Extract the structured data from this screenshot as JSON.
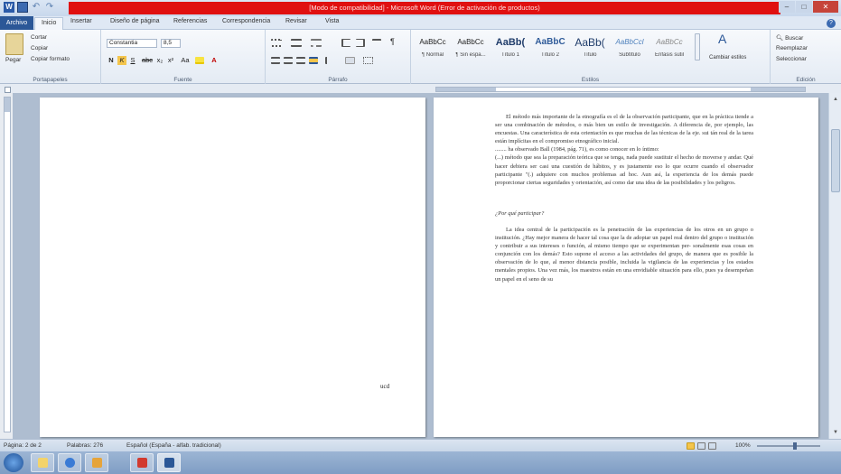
{
  "window": {
    "title": "[Modo de compatibilidad] - Microsoft Word (Error de activación de productos)",
    "minimize": "–",
    "maximize": "□",
    "close": "✕"
  },
  "tabs": {
    "file": "Archivo",
    "items": [
      "Inicio",
      "Insertar",
      "Diseño de página",
      "Referencias",
      "Correspondencia",
      "Revisar",
      "Vista"
    ],
    "help": "?"
  },
  "ribbon": {
    "clipboard": {
      "label": "Portapapeles",
      "paste": "Pegar",
      "cut": "Cortar",
      "copy": "Copiar",
      "format_painter": "Copiar formato"
    },
    "font": {
      "label": "Fuente",
      "font_name": "Constantia",
      "font_size": "8,5",
      "buttons": [
        "N",
        "K",
        "S",
        "abc",
        "x₂",
        "x²",
        "Aa",
        "A"
      ]
    },
    "paragraph": {
      "label": "Párrafo",
      "pilcrow": "¶"
    },
    "styles": {
      "label": "Estilos",
      "items": [
        {
          "sample": "AaBbCc",
          "name": "¶ Normal"
        },
        {
          "sample": "AaBbCc",
          "name": "¶ Sin espa..."
        },
        {
          "sample": "AaBb(",
          "name": "Título 1"
        },
        {
          "sample": "AaBbC",
          "name": "Título 2"
        },
        {
          "sample": "AaBb(",
          "name": "Título"
        },
        {
          "sample": "AaBbCcl",
          "name": "Subtítulo"
        },
        {
          "sample": "AaBbCc",
          "name": "Énfasis sutil"
        }
      ],
      "change_styles": "Cambiar estilos"
    },
    "editing": {
      "label": "Edición",
      "find": "Buscar",
      "replace": "Reemplazar",
      "select": "Seleccionar"
    }
  },
  "document": {
    "page_number": "ucd",
    "paragraphs": [
      "El método más importante de la etnografía es el de la observación partic­ipante, que en la práctica tiende a ser una combinación de métodos, o más bien un estilo de investigación. A diferencia de, por ejemplo, las encuestas. Una característica de esta orientación es que muchas de las técnicas de la eje. sui tán real de la tarea están implícitas en el compromiso etnográfico inicial.",
      "........ ha observado Ball (1984, pág. 71), es como conocer en lo íntimo:",
      "(...) método que sea la preparación teórica que se tenga, nada puede sustituir el hecho de moverse y andar. Qué hacer debiera ser casi una cuestión de hábitos, y es justamente eso lo que ocurre cuando el observador participante \"(.) adquiere con muchos problemas ad hoc. Aun así, la experiencia de los demás puede proporcionar ciertas seguridades y orientación, así como dar una idea de las posibilidades y los peligros.",
      "¿Por qué participar?",
      "La idea central de la participación es la penetración de las experiencias de los otros en un grupo o institución. ¿Hay mejor manera de hacer tal cosa que la de adoptar un papel real dentro del grupo o institución y contribuir a sus intereses o función, al mismo tiempo que se experimentan per- sonalmente esas cosas en conjunción con los demás? Esto supone el acceso a las actividades del grupo, de manera que es posible la observación de lo que, al menor distancia posible, incluida la vigilancia de las experiencias y los estados mentales propios. Una vez más, los maestros están en una envidiable situación para ello, pues ya desempeñan un papel en el seno de su"
    ]
  },
  "statusbar": {
    "page": "Página: 2 de 2",
    "words": "Palabras: 276",
    "language": "Español (España - alfab. tradicional)",
    "zoom": "100%"
  }
}
